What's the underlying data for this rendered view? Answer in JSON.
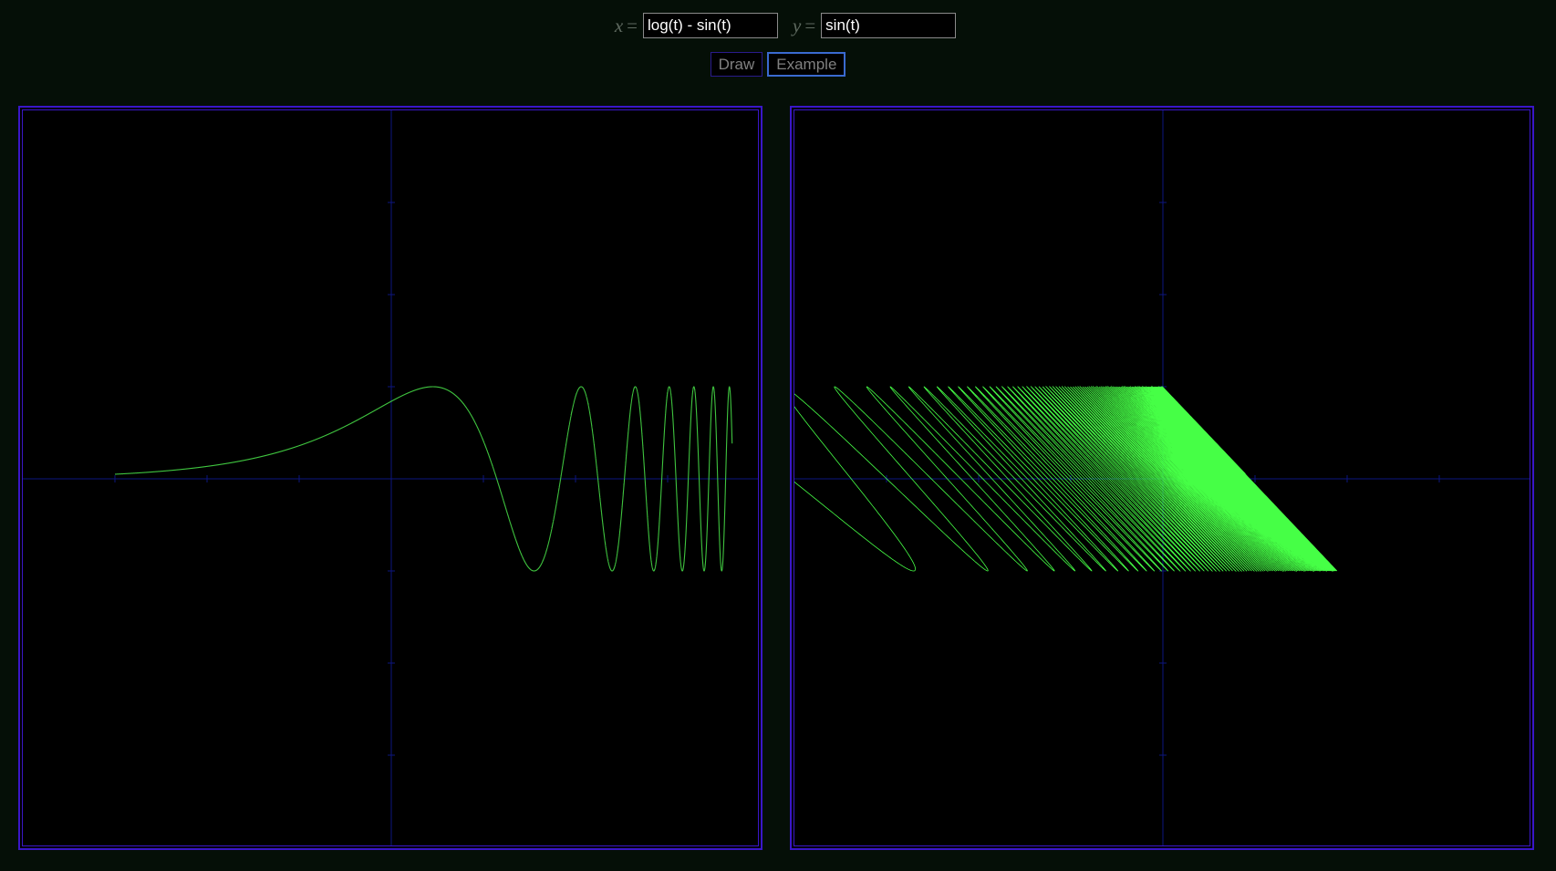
{
  "formula": {
    "x_label": "x",
    "y_label": "y",
    "equals": "=",
    "x_value": "log(t) - sin(t)",
    "y_value": "sin(t)"
  },
  "buttons": {
    "draw_label": "Draw",
    "example_label": "Example"
  },
  "colors": {
    "background": "#050f07",
    "frame": "#3a17c8",
    "axis": "#0d1680",
    "curve_left": "#3fc43f",
    "curve_right": "#46ff46"
  }
}
